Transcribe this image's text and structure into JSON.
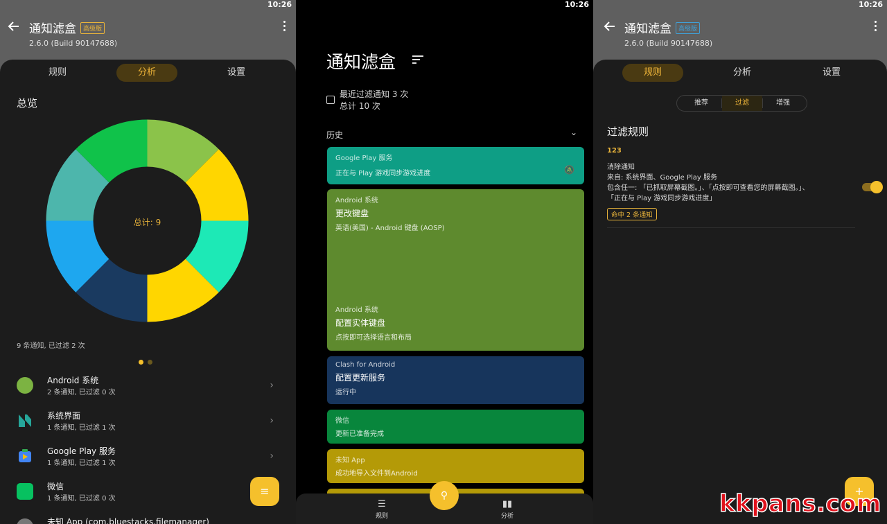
{
  "status_time": "10:26",
  "app": {
    "title": "通知滤盒",
    "pro_badge": "高级版",
    "version": "2.6.0  (Build 90147688)"
  },
  "tabs": [
    "规则",
    "分析",
    "设置"
  ],
  "analysis": {
    "overview_title": "总览",
    "total_label": "总计: 9",
    "summary": "9 条通知, 已过滤 2 次",
    "segments": [
      {
        "color": "#8bc34a",
        "value": 1
      },
      {
        "color": "#ffd600",
        "value": 1
      },
      {
        "color": "#1de9b6",
        "value": 1
      },
      {
        "color": "#ffd600",
        "value": 1
      },
      {
        "color": "#1a3a60",
        "value": 1
      },
      {
        "color": "#1ea7ef",
        "value": 1
      },
      {
        "color": "#4db6ac",
        "value": 1
      },
      {
        "color": "#10c24a",
        "value": 1
      }
    ],
    "apps": [
      {
        "name": "Android 系统",
        "sub": "2 条通知, 已过滤 0 次",
        "icon": "android-system-icon",
        "color": "#7cb342"
      },
      {
        "name": "系统界面",
        "sub": "1 条通知, 已过滤 1 次",
        "icon": "system-ui-icon",
        "color": "#26a69a"
      },
      {
        "name": "Google Play 服务",
        "sub": "1 条通知, 已过滤 1 次",
        "icon": "play-services-icon",
        "color": "#4285f4"
      },
      {
        "name": "微信",
        "sub": "1 条通知, 已过滤 0 次",
        "icon": "wechat-icon",
        "color": "#07c160"
      },
      {
        "name": "未知 App (com.bluestacks.filemanager)",
        "sub": "",
        "icon": "unknown-app-icon",
        "color": "#777777"
      }
    ]
  },
  "main": {
    "title": "通知滤盒",
    "stat1": "最近过滤通知 3 次",
    "stat2": "总计 10 次",
    "history": "历史",
    "cards": [
      {
        "app": "Google Play 服务",
        "title": "",
        "text": "正在与 Play 游戏同步游戏进度",
        "color": "#0e9e85"
      },
      {
        "app": "Android 系统",
        "title": "更改键盘",
        "text": "英语(美国) - Android 键盘 (AOSP)",
        "color": "#5e8a2e"
      },
      {
        "app": "Android 系统",
        "title": "配置实体键盘",
        "text": "点按即可选择语言和布局",
        "color": "#5e8a2e"
      },
      {
        "app": "Clash for Android",
        "title": "配置更新服务",
        "text": "运行中",
        "color": "#17355c"
      },
      {
        "app": "微信",
        "title": "",
        "text": "更新已准备完成",
        "color": "#08863c"
      },
      {
        "app": "未知 App",
        "title": "",
        "text": "成功地导入文件到Android",
        "color": "#b49a07"
      }
    ],
    "nav": [
      {
        "label": "规则"
      },
      {
        "label": "分析"
      }
    ]
  },
  "rules": {
    "segments": [
      "推荐",
      "过滤",
      "增强"
    ],
    "section_title": "过滤规则",
    "rule_name": "123",
    "rule_action": "消除通知",
    "rule_from": "来自: 系统界面、Google Play 服务",
    "rule_contains1": "包含任一: 「已抓取屏幕截图。」、「点按即可查看您的屏幕截图。」、",
    "rule_contains2": "「正在与 Play 游戏同步游戏进度」",
    "rule_hit": "命中 2 条通知"
  },
  "watermark": "kkpans.com"
}
